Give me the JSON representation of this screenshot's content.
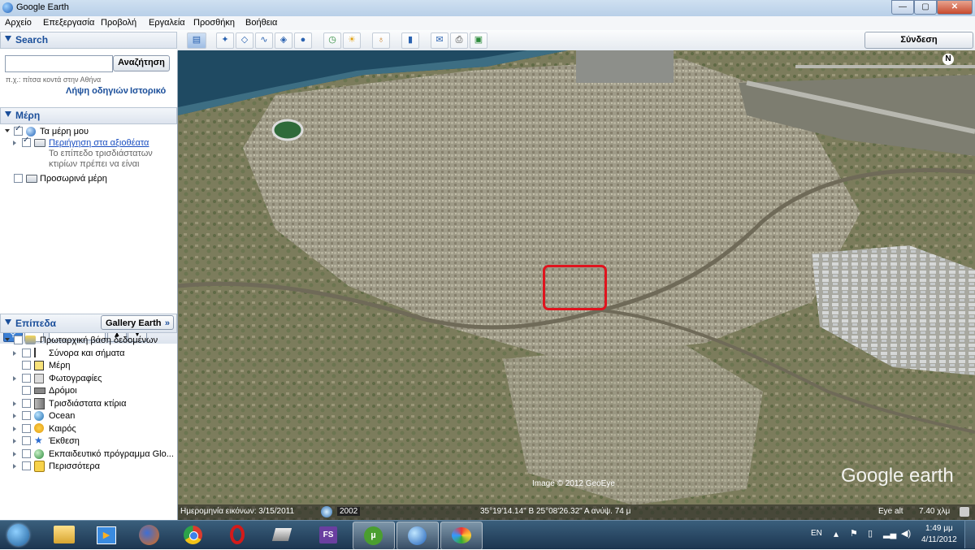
{
  "window": {
    "title": "Google Earth",
    "buttons": {
      "minimize": "—",
      "maximize": "▢",
      "close": "✕"
    }
  },
  "menu": [
    "Αρχείο",
    "Επεξεργασία",
    "Προβολή",
    "Εργαλεία",
    "Προσθήκη",
    "Βοήθεια"
  ],
  "search": {
    "header": "Search",
    "input_value": "",
    "button": "Αναζήτηση",
    "hint": "π.χ.: πίτσα κοντά στην Αθήνα",
    "link_directions": "Λήψη οδηγιών",
    "link_history": "Ιστορικό"
  },
  "places": {
    "header": "Μέρη",
    "my_places": "Τα μέρη μου",
    "tour": "Περιήγηση στα αξιοθέατα",
    "tour_desc_1": "Το επίπεδο τρισδιάστατων",
    "tour_desc_2": "κτιρίων πρέπει να είναι",
    "temporary": "Προσωρινά μέρη"
  },
  "layers": {
    "header": "Επίπεδα",
    "gallery_button": "Gallery Earth",
    "items": [
      "Πρωταρχική βάση δεδομένων",
      "Σύνορα και σήματα",
      "Μέρη",
      "Φωτογραφίες",
      "Δρόμοι",
      "Τρισδιάστατα κτίρια",
      "Ocean",
      "Καιρός",
      "Έκθεση",
      "Εκπαιδευτικό πρόγραμμα Glo...",
      "Περισσότερα"
    ]
  },
  "toolbar": {
    "sign_in": "Σύνδεση"
  },
  "map": {
    "copyright": "Image © 2012 GeoEye",
    "brand": "Google earth",
    "north": "N",
    "highlight_color": "#e0141e"
  },
  "status": {
    "imagery_date": "Ημερομηνία εικόνων: 3/15/2011",
    "year": "2002",
    "coords": "35°19'14.14\" Β  25°08'26.32\" Α  ανύψ.   74 μ",
    "eye_alt_label": "Eye alt",
    "eye_alt_value": "7.40 χλμ"
  },
  "taskbar": {
    "lang": "EN",
    "time": "1:49 μμ",
    "date": "4/11/2012",
    "fs_label": "FS"
  }
}
